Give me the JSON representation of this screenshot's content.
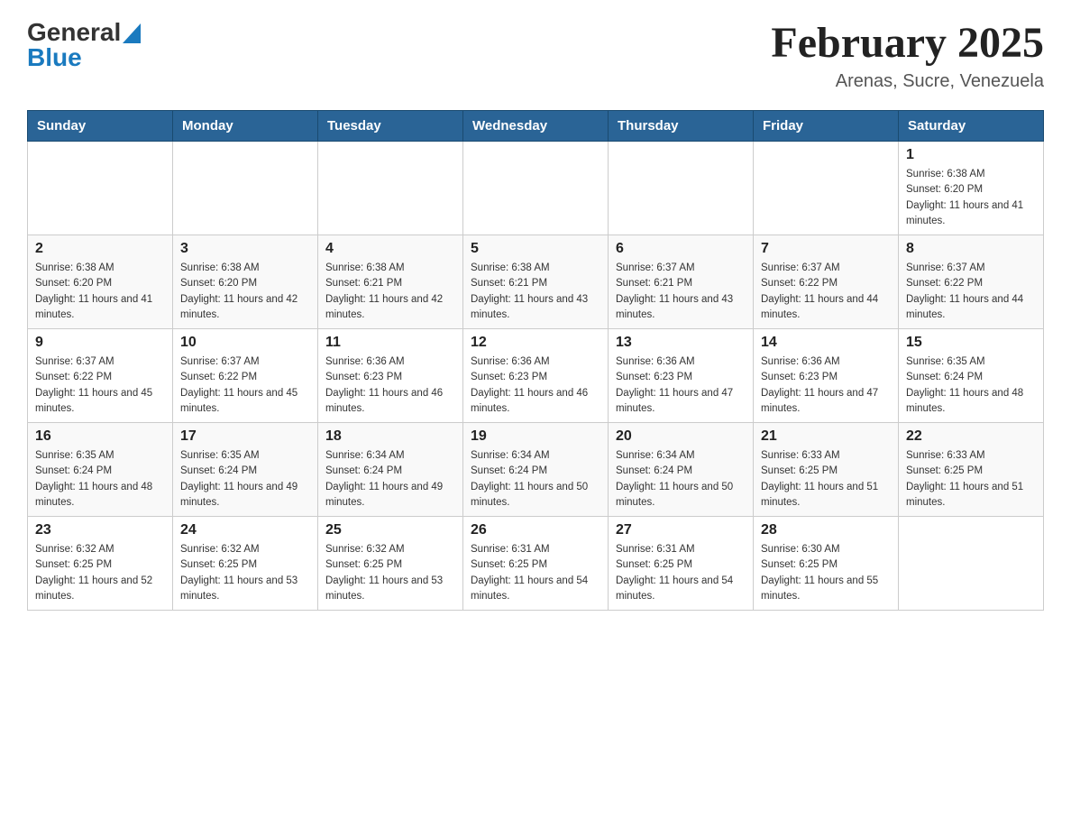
{
  "header": {
    "logo_general": "General",
    "logo_blue": "Blue",
    "month_title": "February 2025",
    "location": "Arenas, Sucre, Venezuela"
  },
  "days_of_week": [
    "Sunday",
    "Monday",
    "Tuesday",
    "Wednesday",
    "Thursday",
    "Friday",
    "Saturday"
  ],
  "weeks": [
    {
      "days": [
        {
          "number": "",
          "info": ""
        },
        {
          "number": "",
          "info": ""
        },
        {
          "number": "",
          "info": ""
        },
        {
          "number": "",
          "info": ""
        },
        {
          "number": "",
          "info": ""
        },
        {
          "number": "",
          "info": ""
        },
        {
          "number": "1",
          "info": "Sunrise: 6:38 AM\nSunset: 6:20 PM\nDaylight: 11 hours and 41 minutes."
        }
      ]
    },
    {
      "days": [
        {
          "number": "2",
          "info": "Sunrise: 6:38 AM\nSunset: 6:20 PM\nDaylight: 11 hours and 41 minutes."
        },
        {
          "number": "3",
          "info": "Sunrise: 6:38 AM\nSunset: 6:20 PM\nDaylight: 11 hours and 42 minutes."
        },
        {
          "number": "4",
          "info": "Sunrise: 6:38 AM\nSunset: 6:21 PM\nDaylight: 11 hours and 42 minutes."
        },
        {
          "number": "5",
          "info": "Sunrise: 6:38 AM\nSunset: 6:21 PM\nDaylight: 11 hours and 43 minutes."
        },
        {
          "number": "6",
          "info": "Sunrise: 6:37 AM\nSunset: 6:21 PM\nDaylight: 11 hours and 43 minutes."
        },
        {
          "number": "7",
          "info": "Sunrise: 6:37 AM\nSunset: 6:22 PM\nDaylight: 11 hours and 44 minutes."
        },
        {
          "number": "8",
          "info": "Sunrise: 6:37 AM\nSunset: 6:22 PM\nDaylight: 11 hours and 44 minutes."
        }
      ]
    },
    {
      "days": [
        {
          "number": "9",
          "info": "Sunrise: 6:37 AM\nSunset: 6:22 PM\nDaylight: 11 hours and 45 minutes."
        },
        {
          "number": "10",
          "info": "Sunrise: 6:37 AM\nSunset: 6:22 PM\nDaylight: 11 hours and 45 minutes."
        },
        {
          "number": "11",
          "info": "Sunrise: 6:36 AM\nSunset: 6:23 PM\nDaylight: 11 hours and 46 minutes."
        },
        {
          "number": "12",
          "info": "Sunrise: 6:36 AM\nSunset: 6:23 PM\nDaylight: 11 hours and 46 minutes."
        },
        {
          "number": "13",
          "info": "Sunrise: 6:36 AM\nSunset: 6:23 PM\nDaylight: 11 hours and 47 minutes."
        },
        {
          "number": "14",
          "info": "Sunrise: 6:36 AM\nSunset: 6:23 PM\nDaylight: 11 hours and 47 minutes."
        },
        {
          "number": "15",
          "info": "Sunrise: 6:35 AM\nSunset: 6:24 PM\nDaylight: 11 hours and 48 minutes."
        }
      ]
    },
    {
      "days": [
        {
          "number": "16",
          "info": "Sunrise: 6:35 AM\nSunset: 6:24 PM\nDaylight: 11 hours and 48 minutes."
        },
        {
          "number": "17",
          "info": "Sunrise: 6:35 AM\nSunset: 6:24 PM\nDaylight: 11 hours and 49 minutes."
        },
        {
          "number": "18",
          "info": "Sunrise: 6:34 AM\nSunset: 6:24 PM\nDaylight: 11 hours and 49 minutes."
        },
        {
          "number": "19",
          "info": "Sunrise: 6:34 AM\nSunset: 6:24 PM\nDaylight: 11 hours and 50 minutes."
        },
        {
          "number": "20",
          "info": "Sunrise: 6:34 AM\nSunset: 6:24 PM\nDaylight: 11 hours and 50 minutes."
        },
        {
          "number": "21",
          "info": "Sunrise: 6:33 AM\nSunset: 6:25 PM\nDaylight: 11 hours and 51 minutes."
        },
        {
          "number": "22",
          "info": "Sunrise: 6:33 AM\nSunset: 6:25 PM\nDaylight: 11 hours and 51 minutes."
        }
      ]
    },
    {
      "days": [
        {
          "number": "23",
          "info": "Sunrise: 6:32 AM\nSunset: 6:25 PM\nDaylight: 11 hours and 52 minutes."
        },
        {
          "number": "24",
          "info": "Sunrise: 6:32 AM\nSunset: 6:25 PM\nDaylight: 11 hours and 53 minutes."
        },
        {
          "number": "25",
          "info": "Sunrise: 6:32 AM\nSunset: 6:25 PM\nDaylight: 11 hours and 53 minutes."
        },
        {
          "number": "26",
          "info": "Sunrise: 6:31 AM\nSunset: 6:25 PM\nDaylight: 11 hours and 54 minutes."
        },
        {
          "number": "27",
          "info": "Sunrise: 6:31 AM\nSunset: 6:25 PM\nDaylight: 11 hours and 54 minutes."
        },
        {
          "number": "28",
          "info": "Sunrise: 6:30 AM\nSunset: 6:25 PM\nDaylight: 11 hours and 55 minutes."
        },
        {
          "number": "",
          "info": ""
        }
      ]
    }
  ]
}
